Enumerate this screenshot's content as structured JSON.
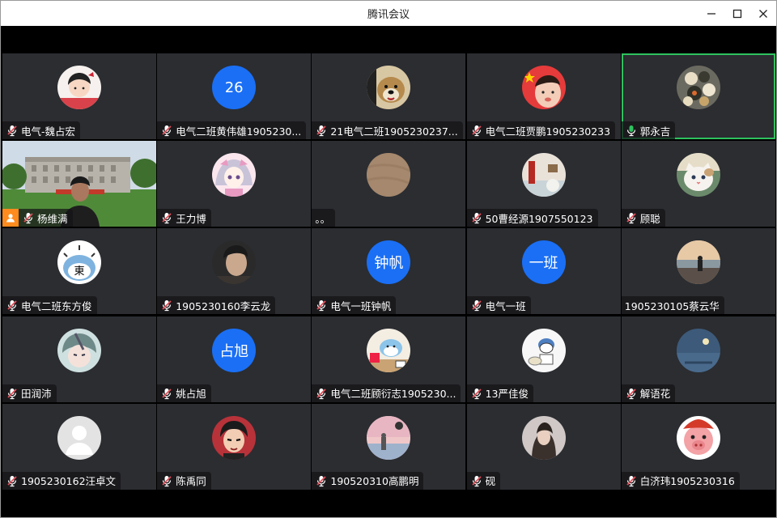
{
  "window": {
    "title": "腾讯会议"
  },
  "colors": {
    "active_speaker": "#2ec25e",
    "avatar_blue": "#1a6ff5",
    "host_badge": "#ff8a1e",
    "mic_muted": "#e0505a"
  },
  "participants": [
    {
      "name": "电气-魏占宏",
      "avatar": {
        "type": "cartoon-boy-icon"
      },
      "mic": "muted"
    },
    {
      "name": "电气二班黄伟雄1905230...",
      "avatar": {
        "type": "text",
        "text": "26"
      },
      "mic": "muted"
    },
    {
      "name": "21电气二班1905230237...",
      "avatar": {
        "type": "dog-icon"
      },
      "mic": "muted"
    },
    {
      "name": "电气二班贾鹏1905230233",
      "avatar": {
        "type": "child-flag-icon"
      },
      "mic": "muted"
    },
    {
      "name": "郭永吉",
      "avatar": {
        "type": "food-icon"
      },
      "mic": "active",
      "active": true
    },
    {
      "name": "杨维满",
      "avatar": {
        "type": "video"
      },
      "mic": "muted",
      "host": true
    },
    {
      "name": "王力博",
      "avatar": {
        "type": "anime-girl-icon"
      },
      "mic": "muted"
    },
    {
      "name": "。。",
      "avatar": {
        "type": "wood-icon"
      },
      "mic": "none"
    },
    {
      "name": "50曹经源1907550123",
      "avatar": {
        "type": "table-icon"
      },
      "mic": "muted"
    },
    {
      "name": "顾聪",
      "avatar": {
        "type": "cat-icon"
      },
      "mic": "muted"
    },
    {
      "name": "电气二班东方俊",
      "avatar": {
        "type": "shark-icon"
      },
      "mic": "muted"
    },
    {
      "name": "1905230160李云龙",
      "avatar": {
        "type": "man-portrait-icon"
      },
      "mic": "muted"
    },
    {
      "name": "电气一班钟帆",
      "avatar": {
        "type": "text",
        "text": "钟帆"
      },
      "mic": "muted"
    },
    {
      "name": "电气一班",
      "avatar": {
        "type": "text",
        "text": "一班"
      },
      "mic": "muted"
    },
    {
      "name": "1905230105蔡云华",
      "avatar": {
        "type": "beach-icon"
      },
      "mic": "none"
    },
    {
      "name": "田润沛",
      "avatar": {
        "type": "anime-boy-icon"
      },
      "mic": "muted"
    },
    {
      "name": "姚占旭",
      "avatar": {
        "type": "text",
        "text": "占旭"
      },
      "mic": "muted"
    },
    {
      "name": "电气二班顾衍志1905230...",
      "avatar": {
        "type": "shark-desk-icon"
      },
      "mic": "muted"
    },
    {
      "name": "13严佳俊",
      "avatar": {
        "type": "cartoon-sketch-icon"
      },
      "mic": "muted"
    },
    {
      "name": "解语花",
      "avatar": {
        "type": "moon-icon"
      },
      "mic": "muted"
    },
    {
      "name": "1905230162汪卓文",
      "avatar": {
        "type": "default-user-icon"
      },
      "mic": "muted"
    },
    {
      "name": "陈禹同",
      "avatar": {
        "type": "comic-man-icon"
      },
      "mic": "muted"
    },
    {
      "name": "190520310高鹏明",
      "avatar": {
        "type": "sunset-girl-icon"
      },
      "mic": "muted"
    },
    {
      "name": "砚",
      "avatar": {
        "type": "girl-portrait-icon"
      },
      "mic": "muted"
    },
    {
      "name": "白济玮1905230316",
      "avatar": {
        "type": "piggy-icon"
      },
      "mic": "muted"
    }
  ]
}
